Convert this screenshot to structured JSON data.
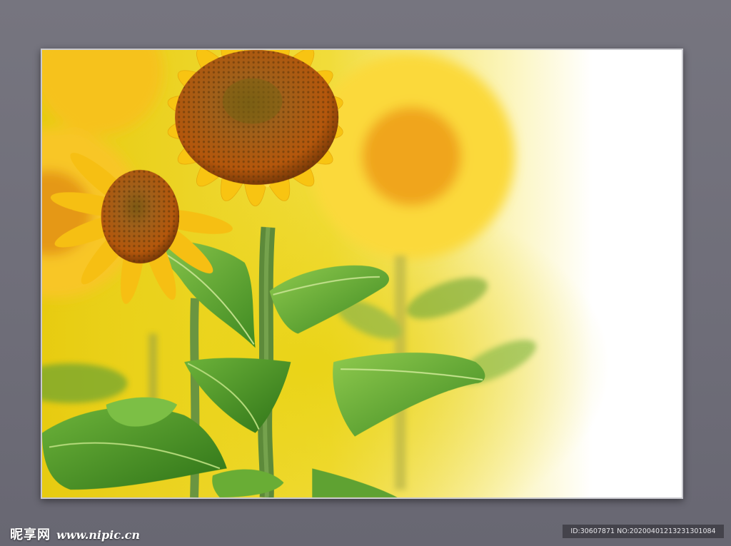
{
  "photo": {
    "subject": "sunflowers",
    "colors": {
      "petal": "#f6c417",
      "petal_light": "#ffe14a",
      "disk": "#b95f0e",
      "disk_center": "#8a5413",
      "leaf": "#4f9a2a",
      "leaf_light": "#8fca4e",
      "stem": "#5e8a3a",
      "background_glow": "#f4dc1a",
      "background_white": "#ffffff"
    }
  },
  "watermark": {
    "site_name": "昵享网",
    "url": "www.nipic.cn",
    "id_line": "ID:30607871 NO:20200401213231301084"
  }
}
